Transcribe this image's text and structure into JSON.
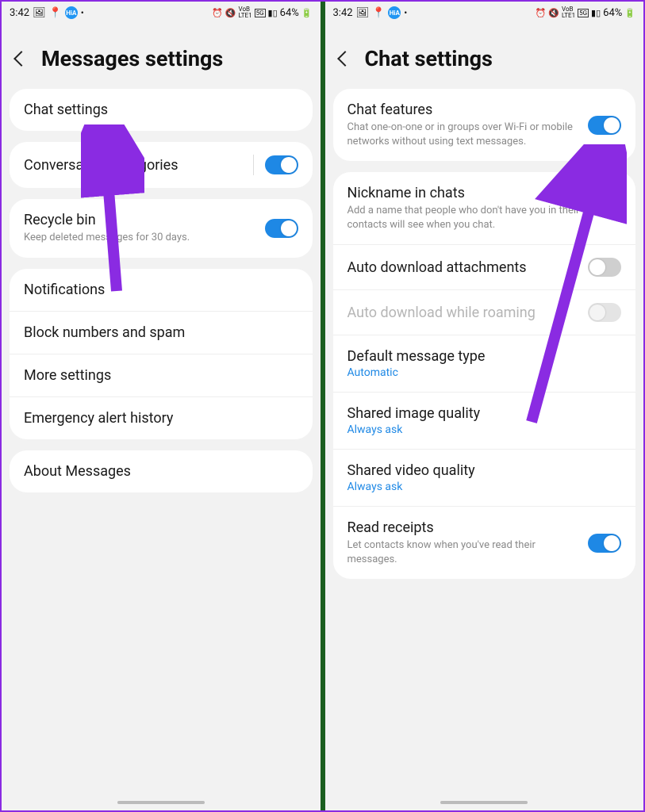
{
  "status": {
    "time": "3:42",
    "battery": "64%"
  },
  "left": {
    "title": "Messages settings",
    "rows": {
      "chat_settings": "Chat settings",
      "conv_cat": "Conversation categories",
      "recycle_title": "Recycle bin",
      "recycle_sub": "Keep deleted messages for 30 days.",
      "notifications": "Notifications",
      "block": "Block numbers and spam",
      "more": "More settings",
      "emergency": "Emergency alert history",
      "about": "About Messages"
    }
  },
  "right": {
    "title": "Chat settings",
    "chat_features": {
      "title": "Chat features",
      "sub": "Chat one-on-one or in groups over Wi-Fi or mobile networks without using text messages."
    },
    "nickname": {
      "title": "Nickname in chats",
      "sub": "Add a name that people who don't have you in their contacts will see when you chat."
    },
    "auto_dl": "Auto download attachments",
    "auto_dl_roam": "Auto download while roaming",
    "default_type": {
      "title": "Default message type",
      "value": "Automatic"
    },
    "img_quality": {
      "title": "Shared image quality",
      "value": "Always ask"
    },
    "vid_quality": {
      "title": "Shared video quality",
      "value": "Always ask"
    },
    "read_receipts": {
      "title": "Read receipts",
      "sub": "Let contacts know when you've read their messages."
    }
  }
}
